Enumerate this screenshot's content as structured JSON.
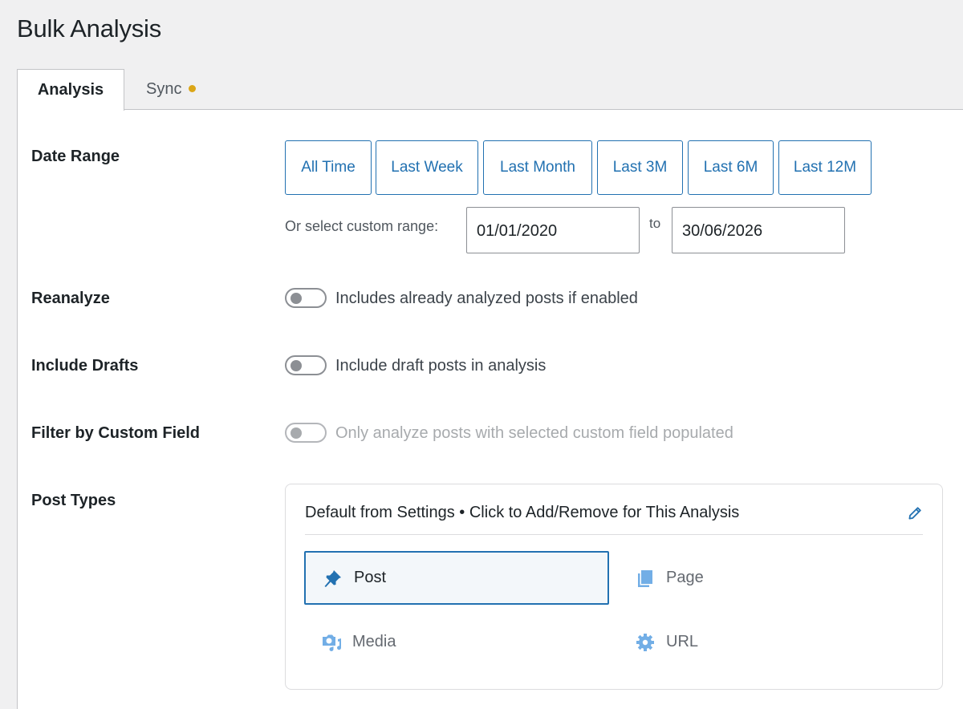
{
  "page": {
    "title": "Bulk Analysis"
  },
  "tabs": [
    {
      "label": "Analysis",
      "active": true
    },
    {
      "label": "Sync",
      "indicator_color": "#dba617"
    }
  ],
  "date_range": {
    "label": "Date Range",
    "buttons": [
      "All Time",
      "Last Week",
      "Last Month",
      "Last 3M",
      "Last 6M",
      "Last 12M"
    ],
    "custom_label": "Or select custom range:",
    "from_value": "01/01/2020",
    "to_label": "to",
    "to_value": "30/06/2026"
  },
  "reanalyze": {
    "label": "Reanalyze",
    "description": "Includes already analyzed posts if enabled",
    "enabled": false
  },
  "include_drafts": {
    "label": "Include Drafts",
    "description": "Include draft posts in analysis",
    "enabled": false
  },
  "filter_custom_field": {
    "label": "Filter by Custom Field",
    "description": "Only analyze posts with selected custom field populated",
    "enabled": false,
    "disabled": true
  },
  "post_types": {
    "label": "Post Types",
    "header": "Default from Settings • Click to Add/Remove for This Analysis",
    "items": [
      {
        "label": "Post",
        "icon": "pin-icon",
        "selected": true
      },
      {
        "label": "Page",
        "icon": "pages-icon",
        "selected": false
      },
      {
        "label": "Media",
        "icon": "media-icon",
        "selected": false
      },
      {
        "label": "URL",
        "icon": "gear-icon",
        "selected": false
      }
    ]
  },
  "colors": {
    "accent": "#2271b1",
    "icon_inactive": "#72aee6",
    "background": "#f0f0f1"
  }
}
